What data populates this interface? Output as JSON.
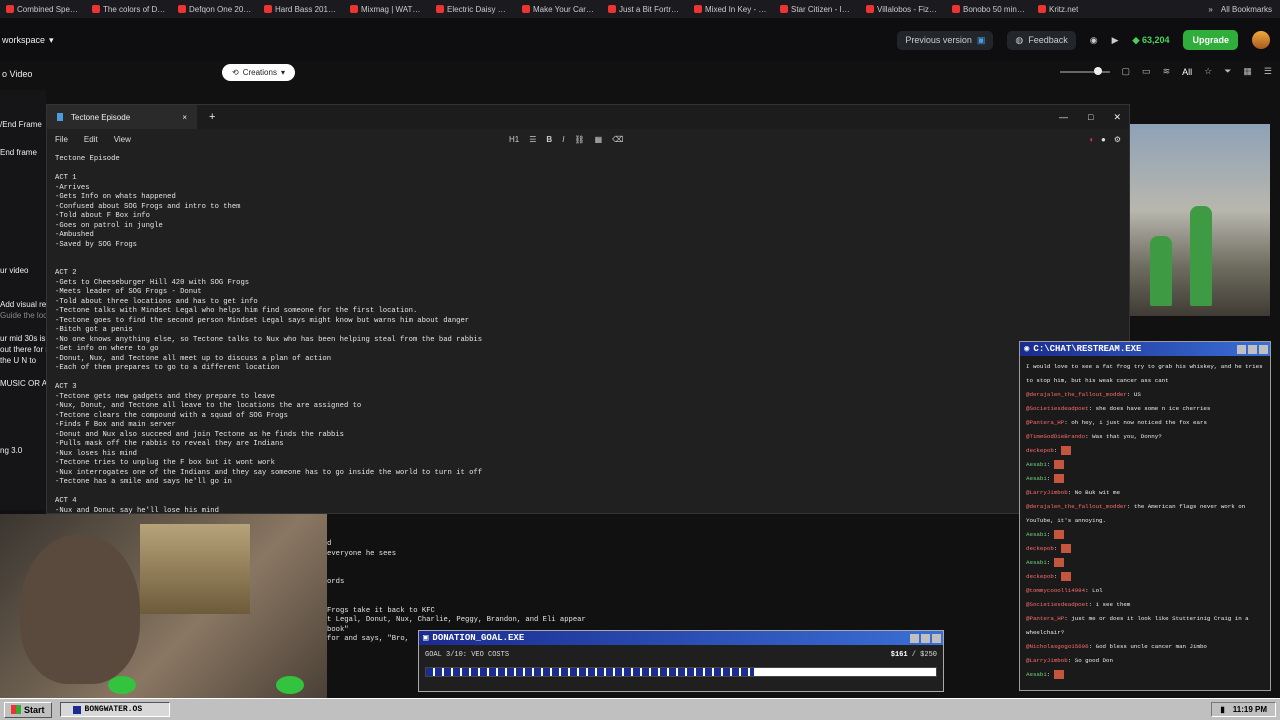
{
  "bookmarks": [
    {
      "label": "Combined Speed To..."
    },
    {
      "label": "The colors of Defgo..."
    },
    {
      "label": "Defqon One 2013 l..."
    },
    {
      "label": "Hard Bass 2013 (Liv..."
    },
    {
      "label": "Mixmag | WATCH D..."
    },
    {
      "label": "Electric Daisy Carniv..."
    },
    {
      "label": "Make Your Car Fast..."
    },
    {
      "label": "Just a Bit Fortress -..."
    },
    {
      "label": "Mixed In Key - DJ S..."
    },
    {
      "label": "Star Citizen - Imgur"
    },
    {
      "label": "Villalobos - Fizheuo..."
    },
    {
      "label": "Bonobo 50 min Boil..."
    },
    {
      "label": "Kritz.net"
    }
  ],
  "all_bookmarks": "All Bookmarks",
  "app": {
    "workspace": "workspace",
    "previous_version": "Previous version",
    "feedback": "Feedback",
    "credits": "63,204",
    "upgrade": "Upgrade",
    "creations": "Creations",
    "all_tab": "All"
  },
  "left_strip": {
    "video": "o Video",
    "end_frame": "/End Frame",
    "end_frame2": "End frame",
    "your_video": "ur video",
    "add_visual": "Add visual re",
    "guide": "Guide the look",
    "desc1": "ur mid 30s is",
    "desc2": "out there for n",
    "desc3": "the U N to",
    "music": "MUSIC OR AL",
    "version": "ng 3.0"
  },
  "notepad": {
    "tab_title": "Tectone Episode",
    "menu_file": "File",
    "menu_edit": "Edit",
    "menu_view": "View",
    "heading_btn": "H1",
    "content": "Tectone Episode\n\nACT 1\n-Arrives\n-Gets Info on whats happened\n-Confused about SOG Frogs and intro to them\n-Told about F Box info\n-Goes on patrol in jungle\n-Ambushed\n-Saved by SOG Frogs\n\n\nACT 2\n-Gets to Cheeseburger Hill 420 with SOG Frogs\n-Meets leader of SOG Frogs - Donut\n-Told about three locations and has to get info\n-Tectone talks with Mindset Legal who helps him find someone for the first location.\n-Tectone goes to find the second person Mindset Legal says might know but warns him about danger\n-Bitch got a penis\n-No one knows anything else, so Tectone talks to Nux who has been helping steal from the bad rabbis\n-Get info on where to go\n-Donut, Nux, and Tectone all meet up to discuss a plan of action\n-Each of them prepares to go to a different location\n\nACT 3\n-Tectone gets new gadgets and they prepare to leave\n-Nux, Donut, and Tectone all leave to the locations the are assigned to\n-Tectone clears the compound with a squad of SOG Frogs\n-Finds F Box and main server\n-Donut and Nux also succeed and join Tectone as he finds the rabbis\n-Pulls mask off the rabbis to reveal they are Indians\n-Nux loses his mind\n-Tectone tries to unplug the F box but it wont work\n-Nux interrogates one of the Indians and they say someone has to go inside the world to turn it off\n-Tectone has a smile and says he'll go in\n\nACT 4\n-Nux and Donut say he'll lose his mind",
    "overflow": "d\neveryone he sees\n\n\nords\n\n\nFrogs take it back to KFC\nt Legal, Donut, Nux, Charlie, Peggy, Brandon, and Eli appear\nbook\"\nfor and says, \"Bro,"
  },
  "chat": {
    "title": "C:\\CHAT\\RESTREAM.EXE",
    "messages": [
      {
        "user": "",
        "text": "I would love to see a fat frog try to grab his whiskey, and he tries to stop him, but his weak cancer ass cant",
        "color": "green"
      },
      {
        "user": "@derajalen_the_fallout_modder",
        "text": "US",
        "color": "red"
      },
      {
        "user": "@Societiesdeadpoet",
        "text": "she does have some n ice cherries",
        "color": "red"
      },
      {
        "user": "@Pantera_HP",
        "text": "oh hey, i just now noticed the fox ears",
        "color": "red"
      },
      {
        "user": "@TimeGodDieBrando",
        "text": "Was that you, Donny?",
        "color": "red"
      },
      {
        "user": "deckepob",
        "text": "",
        "color": "red"
      },
      {
        "user": "Aesabi",
        "text": "",
        "color": "green"
      },
      {
        "user": "Aesabi",
        "text": "",
        "color": "green"
      },
      {
        "user": "@LarryJimbob",
        "text": "No Buk wit me",
        "color": "red"
      },
      {
        "user": "@derajalen_the_fallout_modder",
        "text": "the American flags never work on YouTube, it's annoying.",
        "color": "red"
      },
      {
        "user": "Aesabi",
        "text": "",
        "color": "green"
      },
      {
        "user": "deckepob",
        "text": "",
        "color": "red"
      },
      {
        "user": "Aesabi",
        "text": "",
        "color": "green"
      },
      {
        "user": "deckepob",
        "text": "",
        "color": "red"
      },
      {
        "user": "@tommycoooll14994",
        "text": "Lol",
        "color": "red"
      },
      {
        "user": "@Societiesdeadpoet",
        "text": "i see them",
        "color": "red"
      },
      {
        "user": "@Pantera_HP",
        "text": "just me or does it look like Stutterinig Craig in a wheelchair?",
        "color": "red"
      },
      {
        "user": "@Nicholasgogo15606",
        "text": "God bless uncle cancer man Jimbo",
        "color": "red"
      },
      {
        "user": "@LarryJimbob",
        "text": "So good Don",
        "color": "red"
      },
      {
        "user": "Aesabi",
        "text": "",
        "color": "green"
      }
    ]
  },
  "donation": {
    "title": "DONATION_GOAL.EXE",
    "goal": "GOAL 3/10: VEO COSTS",
    "current": "$161",
    "target": "/ $250",
    "progress": 0.644
  },
  "taskbar": {
    "start": "Start",
    "task": "BONGWATER.OS",
    "time": "11:19 PM"
  },
  "colors": {
    "titlebar_start": "#1b2b8f",
    "titlebar_end": "#3a6fd6",
    "upgrade": "#2fae3c",
    "chat_user_green": "#6fd37a",
    "chat_user_red": "#ff6b6b"
  }
}
